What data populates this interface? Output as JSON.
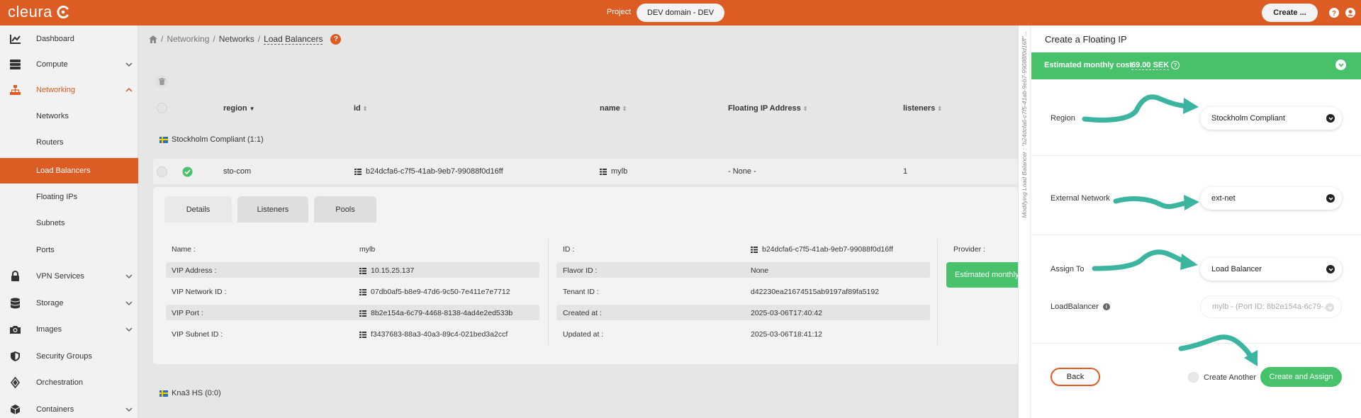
{
  "app": {
    "logo_text": "cleura",
    "project_label": "Project",
    "project_value": "DEV domain - DEV",
    "create_label": "Create ..."
  },
  "sidebar": {
    "items": [
      {
        "label": "Dashboard",
        "icon": "chart-icon"
      },
      {
        "label": "Compute",
        "icon": "server-icon"
      },
      {
        "label": "Networking",
        "icon": "network-icon"
      },
      {
        "label": "Networks"
      },
      {
        "label": "Routers"
      },
      {
        "label": "Load Balancers"
      },
      {
        "label": "Floating IPs"
      },
      {
        "label": "Subnets"
      },
      {
        "label": "Ports"
      },
      {
        "label": "VPN Services",
        "icon": "lock-icon"
      },
      {
        "label": "Storage",
        "icon": "database-icon"
      },
      {
        "label": "Images",
        "icon": "camera-icon"
      },
      {
        "label": "Security Groups",
        "icon": "shield-icon"
      },
      {
        "label": "Orchestration",
        "icon": "orchestration-icon"
      },
      {
        "label": "Containers",
        "icon": "box-icon"
      }
    ],
    "active": "Load Balancers"
  },
  "breadcrumb": {
    "sep": "/",
    "items": [
      "Networking",
      "Networks",
      "Load Balancers"
    ],
    "help": "?"
  },
  "table": {
    "headers": {
      "region": "region",
      "id": "id",
      "name": "name",
      "fip": "Floating IP Address",
      "listeners": "listeners"
    },
    "groups": [
      "Stockholm Compliant (1:1)",
      "Kna3 HS (0:0)"
    ],
    "row": {
      "region": "sto-com",
      "id": "b24dcfa6-c7f5-41ab-9eb7-99088f0d16ff",
      "name": "mylb",
      "fip": "- None -",
      "listeners": "1"
    }
  },
  "detail": {
    "tabs": [
      "Details",
      "Listeners",
      "Pools"
    ],
    "left": [
      {
        "label": "Name :",
        "value": "mylb"
      },
      {
        "label": "VIP Address :",
        "value": "10.15.25.137"
      },
      {
        "label": "VIP Network ID :",
        "value": "07db0af5-b8e9-47d6-9c50-7e411e7e7712"
      },
      {
        "label": "VIP Port :",
        "value": "8b2e154a-6c79-4468-8138-4ad4e2ed533b"
      },
      {
        "label": "VIP Subnet ID :",
        "value": "f3437683-88a3-40a3-89c4-021bed3a2ccf"
      }
    ],
    "right": [
      {
        "label": "ID :",
        "value": "b24dcfa6-c7f5-41ab-9eb7-99088f0d16ff"
      },
      {
        "label": "Flavor ID :",
        "value": "None"
      },
      {
        "label": "Tenant ID :",
        "value": "d42230ea21674515ab9197af89fa5192"
      },
      {
        "label": "Created at :",
        "value": "2025-03-06T17:40:42"
      },
      {
        "label": "Updated at :",
        "value": "2025-03-06T18:41:12"
      }
    ],
    "provider_label": "Provider :",
    "estimated_label": "Estimated monthly"
  },
  "strip_text": "Modifying Load Balancer : \"b24dcfa6-c7f5-41ab-9eb7-99088f0d16ff\"...",
  "drawer": {
    "title": "Create a Floating IP",
    "cost_label": "Estimated monthly cost",
    "cost_value": "69.00 SEK",
    "region_label": "Region",
    "region_value": "Stockholm Compliant",
    "network_label": "External Network",
    "network_value": "ext-net",
    "assign_label": "Assign To",
    "assign_value": "Load Balancer",
    "lb_label": "LoadBalancer",
    "lb_value": "mylb - (Port ID: 8b2e154a-6c79-...",
    "back": "Back",
    "create_another": "Create Another",
    "submit": "Create and Assign"
  },
  "colors": {
    "brand": "#dd5c24",
    "success": "#47c26b",
    "arrow": "#3cb5a0"
  }
}
